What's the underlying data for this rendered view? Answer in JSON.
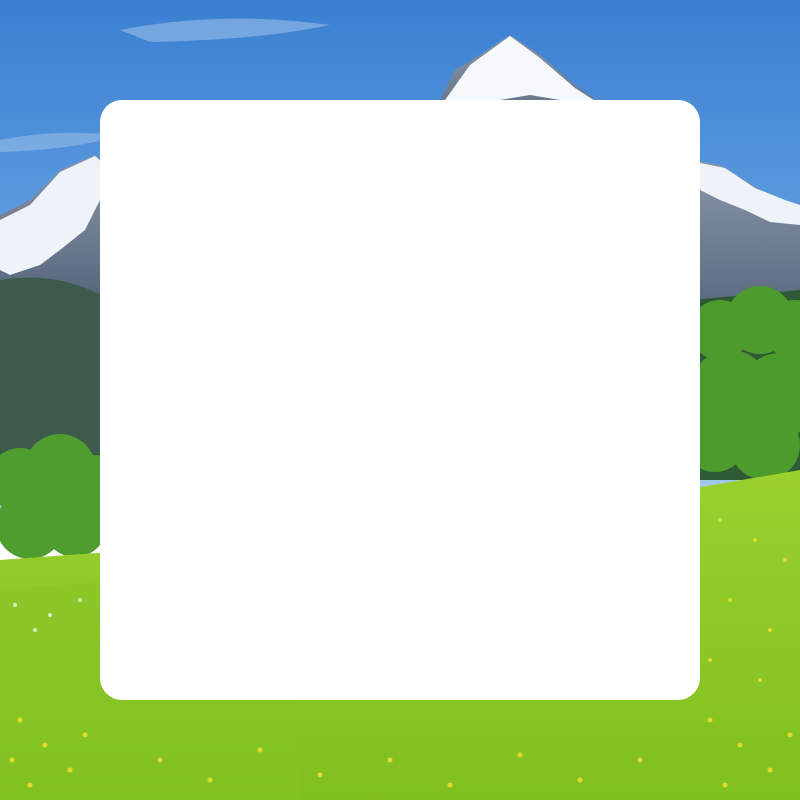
{
  "scene": {
    "background": "alpine-meadow-landscape",
    "colors": {
      "sky_top": "#3f86d6",
      "sky_bottom": "#8fc0ea",
      "snow": "#f4f7fb",
      "rock": "#7d8aa0",
      "forest": "#3f5b4a",
      "tree_green": "#4f9a2e",
      "meadow": "#8fcf2a",
      "flowers": "#f2e02a"
    }
  },
  "card": {
    "color": "#ffffff",
    "content": ""
  }
}
